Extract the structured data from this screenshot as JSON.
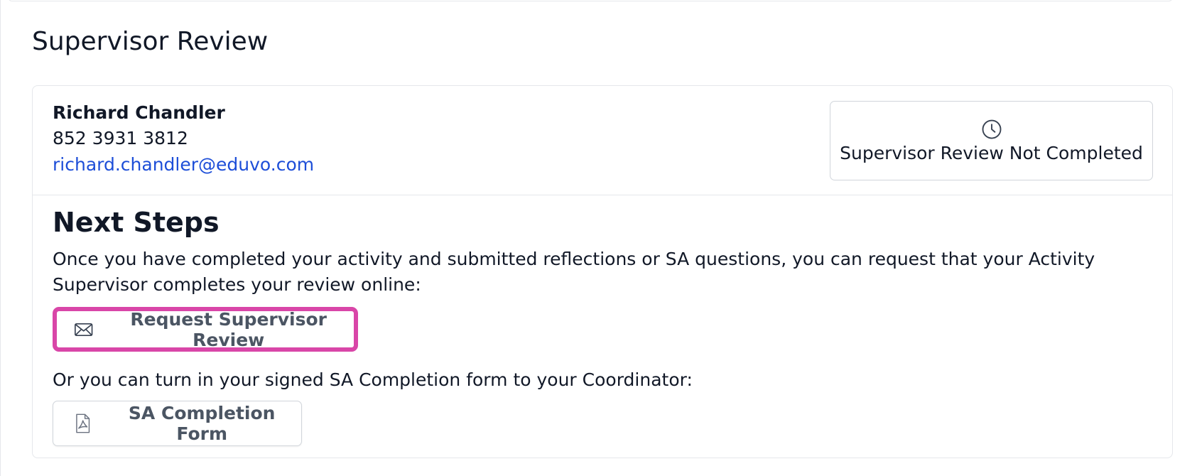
{
  "section": {
    "title": "Supervisor Review"
  },
  "supervisor": {
    "name": "Richard Chandler",
    "phone": "852 3931 3812",
    "email": "richard.chandler@eduvo.com"
  },
  "status": {
    "icon": "clock-icon",
    "text": "Supervisor Review Not Completed"
  },
  "next_steps": {
    "title": "Next Steps",
    "description": "Once you have completed your activity and submitted reflections or SA questions, you can request that your Activity Supervisor completes your review online:",
    "request_button": {
      "label": "Request Supervisor Review",
      "icon": "envelope-icon",
      "highlight_color": "#d946a8"
    },
    "alternative_text": "Or you can turn in your signed SA Completion form to your Coordinator:",
    "form_button": {
      "label": "SA Completion Form",
      "icon": "pdf-file-icon"
    }
  }
}
